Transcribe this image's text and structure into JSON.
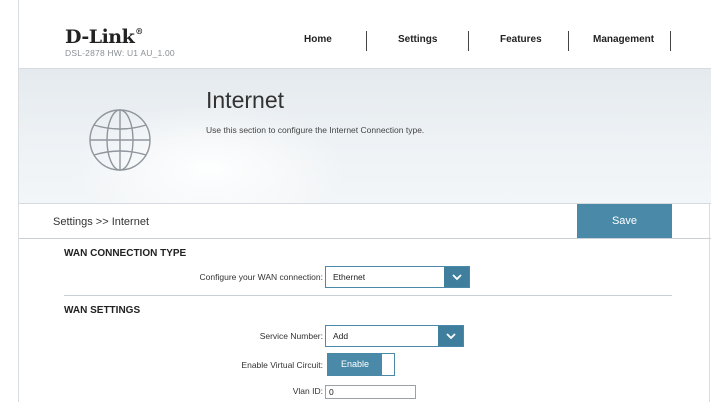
{
  "brand": {
    "logo": "D-Link",
    "model": "DSL-2878   HW: U1   AU_1.00"
  },
  "nav": {
    "items": [
      "Home",
      "Settings",
      "Features",
      "Management"
    ]
  },
  "banner": {
    "title": "Internet",
    "description": "Use this section to configure the Internet Connection type.",
    "icon": "globe-icon"
  },
  "breadcrumb": "Settings >> Internet",
  "save_label": "Save",
  "wan_type": {
    "title": "WAN CONNECTION TYPE",
    "label": "Configure your WAN connection:",
    "value": "Ethernet"
  },
  "wan_settings": {
    "title": "WAN SETTINGS",
    "service_label": "Service Number:",
    "service_value": "Add",
    "virtual_label": "Enable Virtual Circuit:",
    "virtual_value": "Enable",
    "vlan_label": "Vlan ID:",
    "vlan_value": "0"
  },
  "colors": {
    "accent": "#4a8aa8",
    "accent_dark": "#3f7f9d"
  }
}
